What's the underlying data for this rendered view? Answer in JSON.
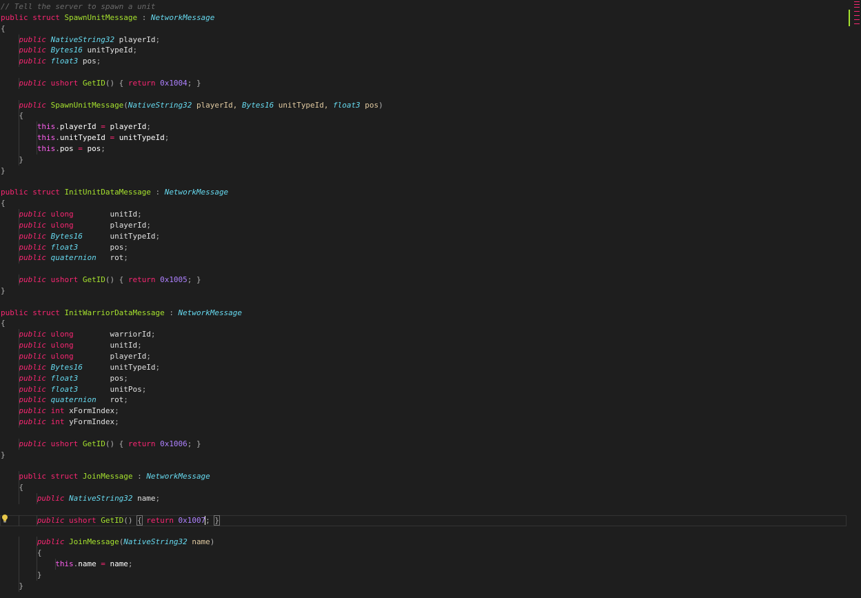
{
  "editor": {
    "lines": [
      [
        {
          "t": "// Tell the server to spawn a unit",
          "c": "comment"
        }
      ],
      [
        {
          "t": "public",
          "c": "keyword"
        },
        {
          "t": " struct ",
          "c": "keyword"
        },
        {
          "t": "SpawnUnitMessage",
          "c": "class"
        },
        {
          "t": " : ",
          "c": "punct"
        },
        {
          "t": "NetworkMessage",
          "c": "type"
        }
      ],
      [
        {
          "t": "{",
          "c": "punct"
        }
      ],
      [
        {
          "t": "    public ",
          "c": "keyword-italic"
        },
        {
          "t": "NativeString32",
          "c": "type"
        },
        {
          "t": " playerId",
          "c": "ident"
        },
        {
          "t": ";",
          "c": "punct"
        }
      ],
      [
        {
          "t": "    public ",
          "c": "keyword-italic"
        },
        {
          "t": "Bytes16",
          "c": "type"
        },
        {
          "t": " unitTypeId",
          "c": "ident"
        },
        {
          "t": ";",
          "c": "punct"
        }
      ],
      [
        {
          "t": "    public ",
          "c": "keyword-italic"
        },
        {
          "t": "float3",
          "c": "type"
        },
        {
          "t": " pos",
          "c": "ident"
        },
        {
          "t": ";",
          "c": "punct"
        }
      ],
      [],
      [
        {
          "t": "    public ",
          "c": "keyword-italic"
        },
        {
          "t": "ushort ",
          "c": "keyword"
        },
        {
          "t": "GetID",
          "c": "func"
        },
        {
          "t": "() { ",
          "c": "punct"
        },
        {
          "t": "return ",
          "c": "keyword"
        },
        {
          "t": "0x1004",
          "c": "number"
        },
        {
          "t": "; }",
          "c": "punct"
        }
      ],
      [],
      [
        {
          "t": "    public ",
          "c": "keyword-italic"
        },
        {
          "t": "SpawnUnitMessage",
          "c": "func"
        },
        {
          "t": "(",
          "c": "punct"
        },
        {
          "t": "NativeString32",
          "c": "type"
        },
        {
          "t": " playerId, ",
          "c": "param"
        },
        {
          "t": "Bytes16",
          "c": "type"
        },
        {
          "t": " unitTypeId, ",
          "c": "param"
        },
        {
          "t": "float3",
          "c": "type"
        },
        {
          "t": " pos",
          "c": "param"
        },
        {
          "t": ")",
          "c": "punct"
        }
      ],
      [
        {
          "t": "    {",
          "c": "punct"
        }
      ],
      [
        {
          "t": "        this",
          "c": "this"
        },
        {
          "t": ".",
          "c": "punct"
        },
        {
          "t": "playerId",
          "c": "member"
        },
        {
          "t": " = ",
          "c": "keyword"
        },
        {
          "t": "playerId",
          "c": "member"
        },
        {
          "t": ";",
          "c": "punct"
        }
      ],
      [
        {
          "t": "        this",
          "c": "this"
        },
        {
          "t": ".",
          "c": "punct"
        },
        {
          "t": "unitTypeId",
          "c": "member"
        },
        {
          "t": " = ",
          "c": "keyword"
        },
        {
          "t": "unitTypeId",
          "c": "member"
        },
        {
          "t": ";",
          "c": "punct"
        }
      ],
      [
        {
          "t": "        this",
          "c": "this"
        },
        {
          "t": ".",
          "c": "punct"
        },
        {
          "t": "pos",
          "c": "member"
        },
        {
          "t": " = ",
          "c": "keyword"
        },
        {
          "t": "pos",
          "c": "member"
        },
        {
          "t": ";",
          "c": "punct"
        }
      ],
      [
        {
          "t": "    }",
          "c": "punct"
        }
      ],
      [
        {
          "t": "}",
          "c": "punct"
        }
      ],
      [],
      [
        {
          "t": "public",
          "c": "keyword"
        },
        {
          "t": " struct ",
          "c": "keyword"
        },
        {
          "t": "InitUnitDataMessage",
          "c": "class"
        },
        {
          "t": " : ",
          "c": "punct"
        },
        {
          "t": "NetworkMessage",
          "c": "type"
        }
      ],
      [
        {
          "t": "{",
          "c": "punct"
        }
      ],
      [
        {
          "t": "    public ",
          "c": "keyword-italic"
        },
        {
          "t": "ulong        ",
          "c": "keyword"
        },
        {
          "t": "unitId",
          "c": "ident"
        },
        {
          "t": ";",
          "c": "punct"
        }
      ],
      [
        {
          "t": "    public ",
          "c": "keyword-italic"
        },
        {
          "t": "ulong        ",
          "c": "keyword"
        },
        {
          "t": "playerId",
          "c": "ident"
        },
        {
          "t": ";",
          "c": "punct"
        }
      ],
      [
        {
          "t": "    public ",
          "c": "keyword-italic"
        },
        {
          "t": "Bytes16",
          "c": "type"
        },
        {
          "t": "      unitTypeId",
          "c": "ident"
        },
        {
          "t": ";",
          "c": "punct"
        }
      ],
      [
        {
          "t": "    public ",
          "c": "keyword-italic"
        },
        {
          "t": "float3",
          "c": "type"
        },
        {
          "t": "       pos",
          "c": "ident"
        },
        {
          "t": ";",
          "c": "punct"
        }
      ],
      [
        {
          "t": "    public ",
          "c": "keyword-italic"
        },
        {
          "t": "quaternion",
          "c": "type"
        },
        {
          "t": "   rot",
          "c": "ident"
        },
        {
          "t": ";",
          "c": "punct"
        }
      ],
      [],
      [
        {
          "t": "    public ",
          "c": "keyword-italic"
        },
        {
          "t": "ushort ",
          "c": "keyword"
        },
        {
          "t": "GetID",
          "c": "func"
        },
        {
          "t": "() { ",
          "c": "punct"
        },
        {
          "t": "return ",
          "c": "keyword"
        },
        {
          "t": "0x1005",
          "c": "number"
        },
        {
          "t": "; }",
          "c": "punct"
        }
      ],
      [
        {
          "t": "}",
          "c": "punct"
        }
      ],
      [],
      [
        {
          "t": "public",
          "c": "keyword"
        },
        {
          "t": " struct ",
          "c": "keyword"
        },
        {
          "t": "InitWarriorDataMessage",
          "c": "class"
        },
        {
          "t": " : ",
          "c": "punct"
        },
        {
          "t": "NetworkMessage",
          "c": "type"
        }
      ],
      [
        {
          "t": "{",
          "c": "punct"
        }
      ],
      [
        {
          "t": "    public ",
          "c": "keyword-italic"
        },
        {
          "t": "ulong        ",
          "c": "keyword"
        },
        {
          "t": "warriorId",
          "c": "ident"
        },
        {
          "t": ";",
          "c": "punct"
        }
      ],
      [
        {
          "t": "    public ",
          "c": "keyword-italic"
        },
        {
          "t": "ulong        ",
          "c": "keyword"
        },
        {
          "t": "unitId",
          "c": "ident"
        },
        {
          "t": ";",
          "c": "punct"
        }
      ],
      [
        {
          "t": "    public ",
          "c": "keyword-italic"
        },
        {
          "t": "ulong        ",
          "c": "keyword"
        },
        {
          "t": "playerId",
          "c": "ident"
        },
        {
          "t": ";",
          "c": "punct"
        }
      ],
      [
        {
          "t": "    public ",
          "c": "keyword-italic"
        },
        {
          "t": "Bytes16",
          "c": "type"
        },
        {
          "t": "      unitTypeId",
          "c": "ident"
        },
        {
          "t": ";",
          "c": "punct"
        }
      ],
      [
        {
          "t": "    public ",
          "c": "keyword-italic"
        },
        {
          "t": "float3",
          "c": "type"
        },
        {
          "t": "       pos",
          "c": "ident"
        },
        {
          "t": ";",
          "c": "punct"
        }
      ],
      [
        {
          "t": "    public ",
          "c": "keyword-italic"
        },
        {
          "t": "float3",
          "c": "type"
        },
        {
          "t": "       unitPos",
          "c": "ident"
        },
        {
          "t": ";",
          "c": "punct"
        }
      ],
      [
        {
          "t": "    public ",
          "c": "keyword-italic"
        },
        {
          "t": "quaternion",
          "c": "type"
        },
        {
          "t": "   rot",
          "c": "ident"
        },
        {
          "t": ";",
          "c": "punct"
        }
      ],
      [
        {
          "t": "    public ",
          "c": "keyword-italic"
        },
        {
          "t": "int ",
          "c": "keyword"
        },
        {
          "t": "xFormIndex",
          "c": "ident"
        },
        {
          "t": ";",
          "c": "punct"
        }
      ],
      [
        {
          "t": "    public ",
          "c": "keyword-italic"
        },
        {
          "t": "int ",
          "c": "keyword"
        },
        {
          "t": "yFormIndex",
          "c": "ident"
        },
        {
          "t": ";",
          "c": "punct"
        }
      ],
      [],
      [
        {
          "t": "    public ",
          "c": "keyword-italic"
        },
        {
          "t": "ushort ",
          "c": "keyword"
        },
        {
          "t": "GetID",
          "c": "func"
        },
        {
          "t": "() { ",
          "c": "punct"
        },
        {
          "t": "return ",
          "c": "keyword"
        },
        {
          "t": "0x1006",
          "c": "number"
        },
        {
          "t": "; }",
          "c": "punct"
        }
      ],
      [
        {
          "t": "}",
          "c": "punct"
        }
      ],
      [],
      [
        {
          "t": "    public",
          "c": "keyword"
        },
        {
          "t": " struct ",
          "c": "keyword"
        },
        {
          "t": "JoinMessage",
          "c": "class"
        },
        {
          "t": " : ",
          "c": "punct"
        },
        {
          "t": "NetworkMessage",
          "c": "type"
        }
      ],
      [
        {
          "t": "    {",
          "c": "punct"
        }
      ],
      [
        {
          "t": "        public ",
          "c": "keyword-italic"
        },
        {
          "t": "NativeString32",
          "c": "type"
        },
        {
          "t": " name",
          "c": "ident"
        },
        {
          "t": ";",
          "c": "punct"
        }
      ],
      [],
      [
        {
          "t": "        public ",
          "c": "keyword-italic"
        },
        {
          "t": "ushort ",
          "c": "keyword"
        },
        {
          "t": "GetID",
          "c": "func"
        },
        {
          "t": "() ",
          "c": "punct"
        },
        {
          "t": "{",
          "c": "bracket"
        },
        {
          "t": " return ",
          "c": "keyword"
        },
        {
          "t": "0x1007",
          "c": "number"
        },
        {
          "t": "",
          "c": "cursor"
        },
        {
          "t": "; ",
          "c": "punct"
        },
        {
          "t": "}",
          "c": "bracket"
        }
      ],
      [],
      [
        {
          "t": "        public ",
          "c": "keyword-italic"
        },
        {
          "t": "JoinMessage",
          "c": "func"
        },
        {
          "t": "(",
          "c": "punct"
        },
        {
          "t": "NativeString32",
          "c": "type"
        },
        {
          "t": " name",
          "c": "param"
        },
        {
          "t": ")",
          "c": "punct"
        }
      ],
      [
        {
          "t": "        {",
          "c": "punct"
        }
      ],
      [
        {
          "t": "            this",
          "c": "this"
        },
        {
          "t": ".",
          "c": "punct"
        },
        {
          "t": "name",
          "c": "member"
        },
        {
          "t": " = ",
          "c": "keyword"
        },
        {
          "t": "name",
          "c": "member"
        },
        {
          "t": ";",
          "c": "punct"
        }
      ],
      [
        {
          "t": "        }",
          "c": "punct"
        }
      ],
      [
        {
          "t": "    }",
          "c": "punct"
        }
      ]
    ],
    "current_line": 47,
    "lightbulb_icon": "lightbulb-icon"
  },
  "colors": {
    "background": "#1e1e1e",
    "keyword": "#f92672",
    "type": "#66d9ef",
    "function": "#a6e22e",
    "number": "#ae81ff"
  }
}
